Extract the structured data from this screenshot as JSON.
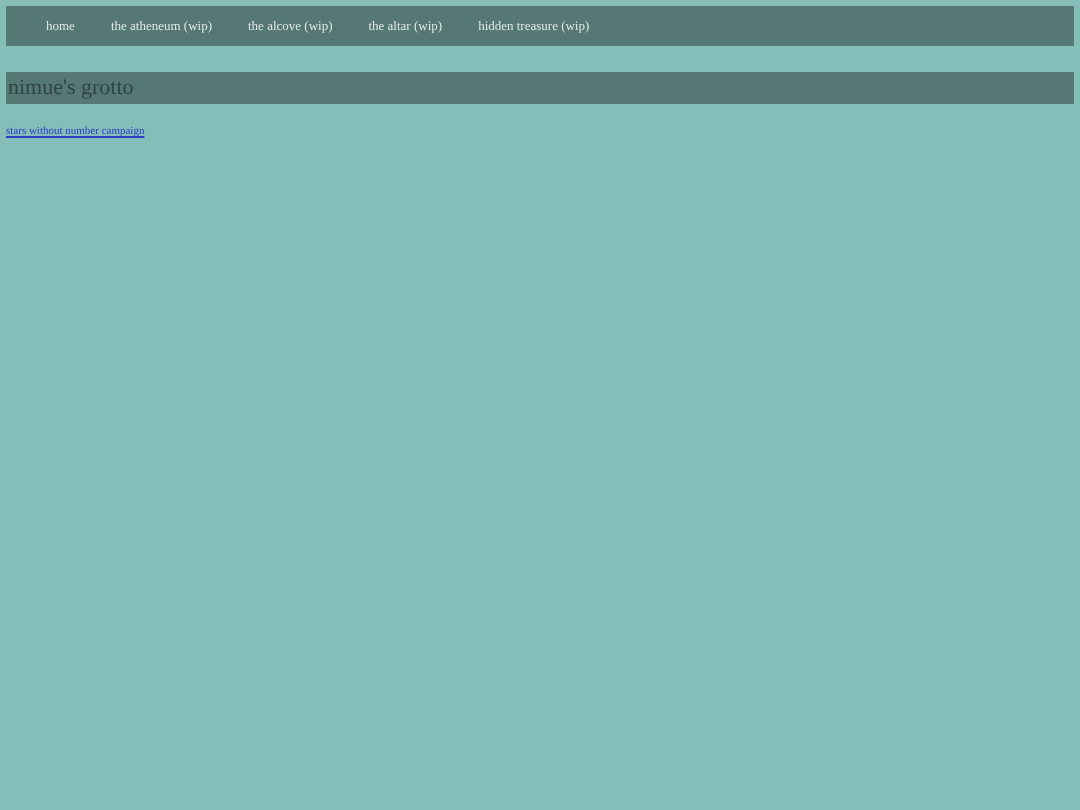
{
  "nav": [
    {
      "label": "home"
    },
    {
      "label": "the atheneum (wip)"
    },
    {
      "label": "the alcove (wip)"
    },
    {
      "label": "the altar (wip)"
    },
    {
      "label": "hidden treasure (wip)"
    }
  ],
  "title": "nimue's grotto",
  "links": [
    "stars without number campaign"
  ]
}
